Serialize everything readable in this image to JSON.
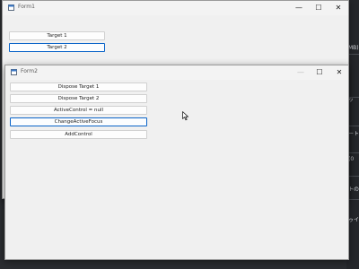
{
  "background_app": {
    "fragments": [
      "MB)",
      "ッ",
      "ート",
      "(0",
      "トの",
      "ゥイ"
    ]
  },
  "form1": {
    "title": "Form1",
    "controls": {
      "minimize": "—",
      "maximize": "☐",
      "close": "✕"
    },
    "buttons": [
      "Target 1",
      "Target 2"
    ]
  },
  "form2": {
    "title": "Form2",
    "controls": {
      "minimize": "—",
      "maximize": "☐",
      "close": "✕"
    },
    "buttons": [
      "Dispose Target 1",
      "Dispose Target 2",
      "ActiveControl = null",
      "ChangeActiveFocus",
      "AddControl"
    ]
  },
  "colors": {
    "window_bg": "#f0f0f0",
    "focus_border": "#0a64c8",
    "desktop": "#2b2d31"
  }
}
